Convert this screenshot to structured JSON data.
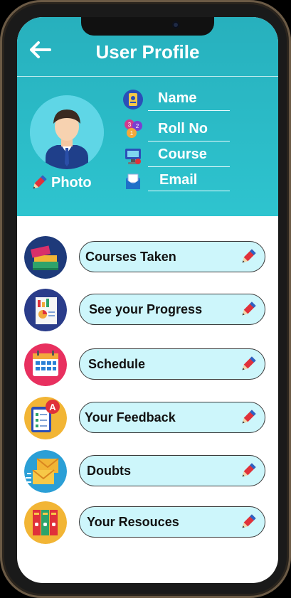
{
  "header": {
    "title": "User Profile"
  },
  "profile": {
    "photo_label": "Photo",
    "fields": [
      {
        "label": "Name",
        "icon": "id-badge-icon"
      },
      {
        "label": "Roll No",
        "icon": "numbers-icon"
      },
      {
        "label": "Course",
        "icon": "monitor-icon"
      },
      {
        "label": "Email",
        "icon": "envelope-icon"
      }
    ]
  },
  "menu": {
    "items": [
      {
        "label": "Courses Taken",
        "icon": "books-icon"
      },
      {
        "label": "See your Progress",
        "icon": "progress-report-icon"
      },
      {
        "label": "Schedule",
        "icon": "calendar-icon"
      },
      {
        "label": "Your Feedback",
        "icon": "feedback-icon"
      },
      {
        "label": "Doubts",
        "icon": "mail-icon"
      },
      {
        "label": "Your Resouces",
        "icon": "binders-icon"
      }
    ]
  },
  "colors": {
    "header": "#2ec4cf",
    "button_fill": "#cdf6fb",
    "pencil_red": "#e0313a",
    "pencil_blue": "#2b63c6"
  }
}
